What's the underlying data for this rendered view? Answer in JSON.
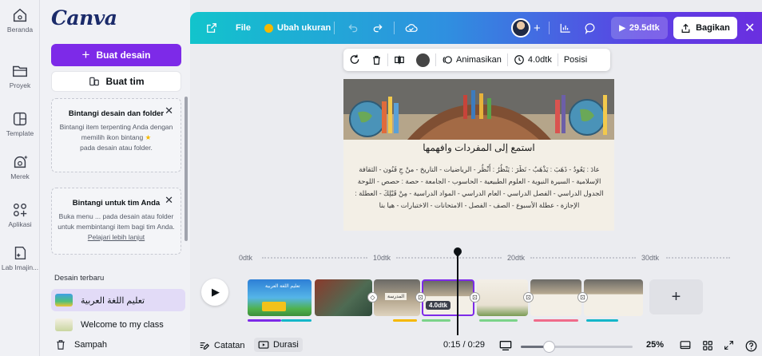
{
  "rail": [
    {
      "label": "Beranda",
      "icon": "home-icon"
    },
    {
      "label": "Proyek",
      "icon": "folder-icon"
    },
    {
      "label": "Template",
      "icon": "template-icon"
    },
    {
      "label": "Merek",
      "icon": "brand-icon"
    },
    {
      "label": "Aplikasi",
      "icon": "apps-icon"
    },
    {
      "label": "Lab Imajin...",
      "icon": "magic-lab-icon"
    }
  ],
  "panel": {
    "logo": "Canva",
    "create_label": "Buat desain",
    "team_label": "Buat tim",
    "card1": {
      "title": "Bintangi desain dan folder",
      "body": "Bintangi item terpenting Anda dengan memilih ikon bintang",
      "body2": "pada desain atau folder."
    },
    "card2": {
      "title": "Bintangi untuk tim Anda",
      "body": "Buka menu ... pada desain atau folder untuk membintangi item bagi tim Anda.",
      "link": "Pelajari lebih lanjut"
    },
    "recent_title": "Desain terbaru",
    "recent": [
      {
        "label": "تعليم اللغة العربية"
      },
      {
        "label": "Welcome to my class"
      }
    ],
    "trash_label": "Sampah"
  },
  "topbar": {
    "file": "File",
    "resize": "Ubah ukuran",
    "play": "29.5dtk",
    "share": "Bagikan"
  },
  "context_toolbar": {
    "animate": "Animasikan",
    "duration": "4.0dtk",
    "position": "Posisi"
  },
  "design": {
    "title": "استمع إلى المفردات وافهمها",
    "body": "عادَ : يَعُودُ - ذَهَبَ : يَذْهَبُ - نَظَرَ : يَنْظُرُ : أَنْظُر - الرياضيات - التاريخ - منْ جِ فَنُون - الثقافة الإسلامية - السيرة النبوية - العلوم الطبيعية - الحاسوب - الجامعة - حصة : حصص - اللوحة الجدول الدراسي - الفصل الدراسي - العام الدراسي - المواد الدراسية - مِنْ قَبْلِكَ - العطلة : الإجازة - عطلة الأسبوع - الصف - الفصل - الامتحانات - الاختبارات - هيا بنا"
  },
  "timeline": {
    "ticks": [
      "0dtk",
      "10dtk",
      "20dtk",
      "30dtk"
    ],
    "selected_duration": "4.0dtk",
    "clip3_label": "المدرسة",
    "clip1_label": "تعليم اللغة العربية"
  },
  "bottombar": {
    "notes": "Catatan",
    "duration": "Durasi",
    "time": "0:15 / 0:29",
    "zoom": "25%"
  },
  "colors": {
    "accent": "#7d2ae8",
    "topbar_start": "#12c4cc",
    "topbar_end": "#6a2fe0"
  }
}
